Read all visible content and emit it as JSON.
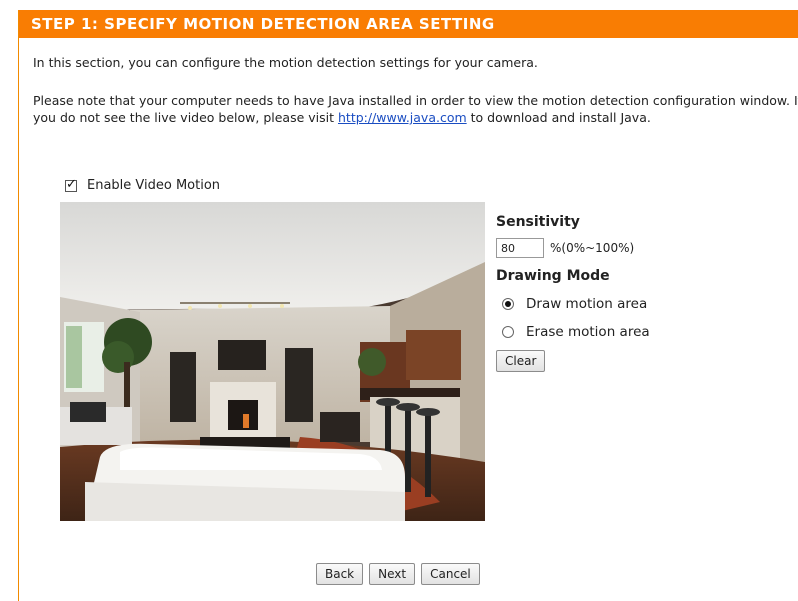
{
  "section": {
    "title": "STEP 1: SPECIFY MOTION DETECTION AREA SETTING",
    "intro": "In this section, you can configure the motion detection settings for your camera.",
    "note_before_link": "Please note that your computer needs to have Java installed in order to view the motion detection configuration window. If you do not see the live video below, please visit ",
    "java_link": "http://www.java.com",
    "note_after_link": " to download and install Java."
  },
  "enable_video_motion": {
    "label": "Enable Video Motion",
    "checked": true
  },
  "sensitivity": {
    "label": "Sensitivity",
    "value": "80",
    "range": "%(0%~100%)"
  },
  "drawing_mode": {
    "label": "Drawing Mode",
    "options": [
      {
        "label": "Draw motion area",
        "selected": true
      },
      {
        "label": "Erase motion area",
        "selected": false
      }
    ]
  },
  "buttons": {
    "clear": "Clear",
    "back": "Back",
    "next": "Next",
    "cancel": "Cancel"
  },
  "colors": {
    "header_bg": "#f97d03",
    "link": "#1a4dc2"
  }
}
